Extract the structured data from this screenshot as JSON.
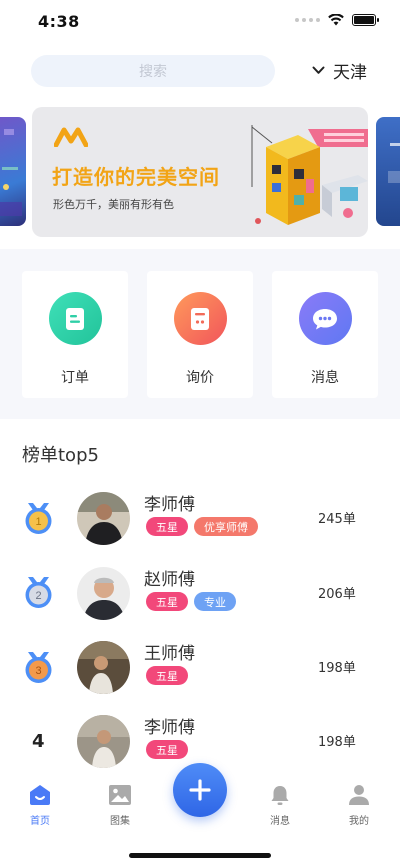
{
  "status_bar": {
    "time": "4:38"
  },
  "header": {
    "search_placeholder": "搜索",
    "city": "天津"
  },
  "banner": {
    "title": "打造你的完美空间",
    "subtitle": "形色万千，美丽有形有色"
  },
  "actions": [
    {
      "label": "订单",
      "icon": "order-icon"
    },
    {
      "label": "询价",
      "icon": "inquiry-icon"
    },
    {
      "label": "消息",
      "icon": "message-icon"
    }
  ],
  "ranking": {
    "title": "榜单top5",
    "items": [
      {
        "rank": "1",
        "name": "李师傅",
        "tags": [
          "五星",
          "优享师傅"
        ],
        "count": "245单"
      },
      {
        "rank": "2",
        "name": "赵师傅",
        "tags": [
          "五星",
          "专业"
        ],
        "count": "206单"
      },
      {
        "rank": "3",
        "name": "王师傅",
        "tags": [
          "五星"
        ],
        "count": "198单"
      },
      {
        "rank": "4",
        "name": "李师傅",
        "tags": [
          "五星"
        ],
        "count": "198单"
      }
    ]
  },
  "tabbar": {
    "items": [
      {
        "label": "首页",
        "icon": "home-icon",
        "active": true
      },
      {
        "label": "图集",
        "icon": "gallery-icon",
        "active": false
      },
      {
        "label": "消息",
        "icon": "bell-icon",
        "active": false
      },
      {
        "label": "我的",
        "icon": "profile-icon",
        "active": false
      }
    ]
  },
  "colors": {
    "accent": "#4a7af6",
    "banner_title": "#f2a416",
    "star_tag": "#f2487a",
    "premium_tag": "#f4786b",
    "pro_tag": "#6ea2f4"
  }
}
